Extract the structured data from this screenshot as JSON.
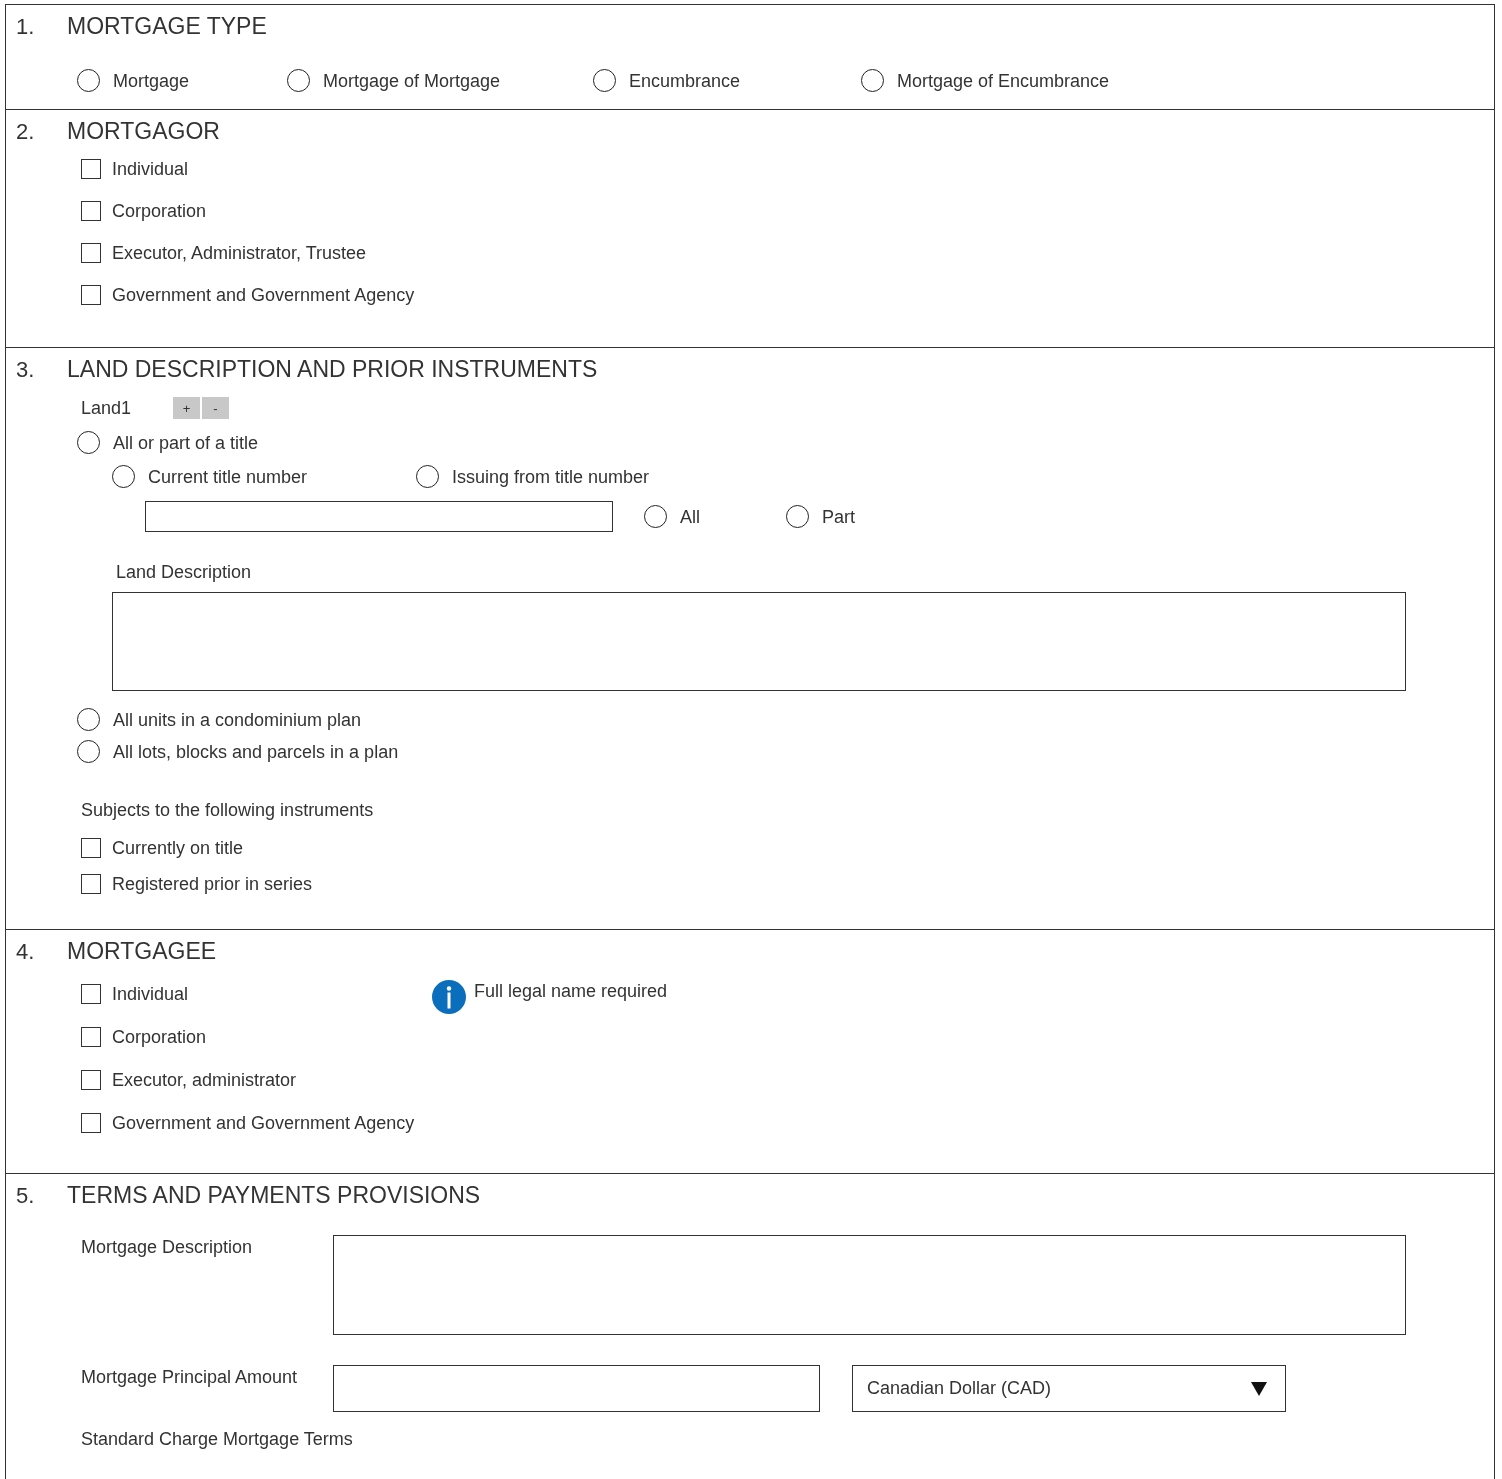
{
  "mortgage_type": {
    "number": "1.",
    "title": "MORTGAGE TYPE",
    "options": [
      {
        "label": "Mortgage",
        "selected": false
      },
      {
        "label": "Mortgage of Mortgage",
        "selected": false
      },
      {
        "label": "Encumbrance",
        "selected": false
      },
      {
        "label": "Mortgage of Encumbrance",
        "selected": false
      }
    ]
  },
  "mortgagor": {
    "number": "2.",
    "title": "MORTGAGOR",
    "options": [
      {
        "label": "Individual",
        "checked": false
      },
      {
        "label": "Corporation",
        "checked": false
      },
      {
        "label": "Executor, Administrator, Trustee",
        "checked": false
      },
      {
        "label": "Government and Government Agency",
        "checked": false
      }
    ]
  },
  "land": {
    "number": "3.",
    "title": "LAND DESCRIPTION AND PRIOR INSTRUMENTS",
    "land_label": "Land1",
    "add_button": "+",
    "remove_button": "-",
    "all_or_part": {
      "label": "All or part of a title",
      "selected": false
    },
    "title_choice": [
      {
        "label": "Current title number",
        "selected": false
      },
      {
        "label": "Issuing from title number",
        "selected": false
      }
    ],
    "scope": [
      {
        "label": "All",
        "selected": false
      },
      {
        "label": "Part",
        "selected": false
      }
    ],
    "land_description_label": "Land Description",
    "plan_options": [
      {
        "label": "All units in a condominium plan",
        "selected": false
      },
      {
        "label": "All lots, blocks and parcels in a plan",
        "selected": false
      }
    ],
    "instruments_label": "Subjects to the following instruments",
    "instruments": [
      {
        "label": "Currently on title",
        "checked": false
      },
      {
        "label": "Registered prior in series",
        "checked": false
      }
    ]
  },
  "mortgagee": {
    "number": "4.",
    "title": "MORTGAGEE",
    "options": [
      {
        "label": "Individual",
        "checked": false
      },
      {
        "label": "Corporation",
        "checked": false
      },
      {
        "label": "Executor, administrator",
        "checked": false
      },
      {
        "label": "Government and Government Agency",
        "checked": false
      }
    ],
    "info_note": "Full legal name required"
  },
  "terms": {
    "number": "5.",
    "title": "TERMS AND PAYMENTS PROVISIONS",
    "description_label": "Mortgage Description",
    "principal_label": "Mortgage Principal Amount",
    "currency": "Canadian Dollar (CAD)",
    "standard_terms_label": "Standard Charge Mortgage Terms"
  }
}
